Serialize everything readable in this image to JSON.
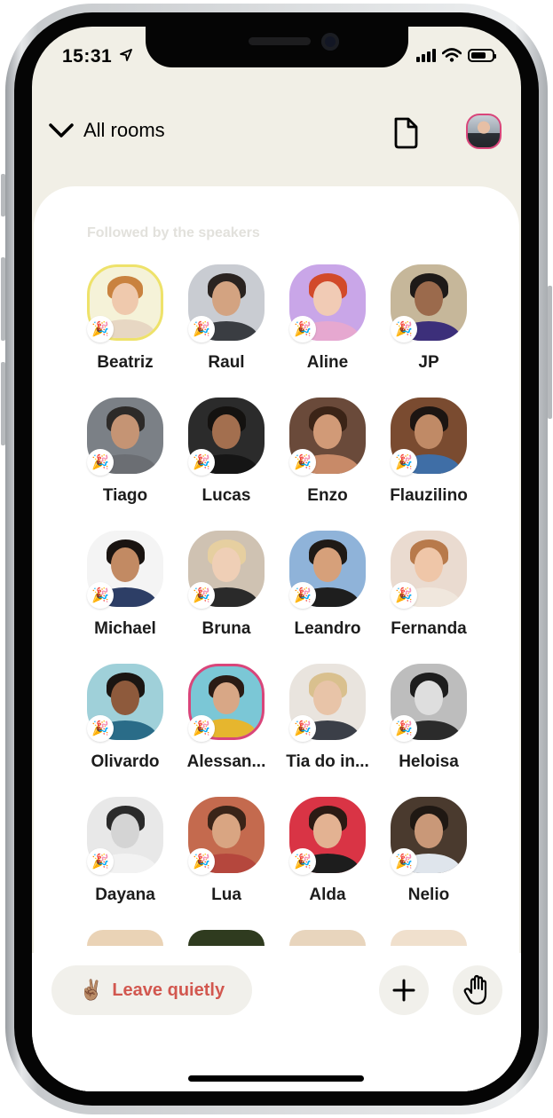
{
  "status_bar": {
    "time": "15:31"
  },
  "header": {
    "back_label": "All rooms"
  },
  "section": {
    "title": "Followed by the speakers"
  },
  "speakers": [
    {
      "name": "Beatriz",
      "ring": "yellow",
      "skin": "#efc9ad",
      "hair": "#c9823f",
      "shirt": "#e7d7c3",
      "bg": "#f5f2d8"
    },
    {
      "name": "Raul",
      "ring": "none",
      "skin": "#d3a381",
      "hair": "#2a2320",
      "shirt": "#3a3d42",
      "bg": "#c9ccd2"
    },
    {
      "name": "Aline",
      "ring": "none",
      "skin": "#f1cbb5",
      "hair": "#d24a2a",
      "shirt": "#e6a8d0",
      "bg": "#c9a6e8"
    },
    {
      "name": "JP",
      "ring": "none",
      "skin": "#9b6a4c",
      "hair": "#1e1a18",
      "shirt": "#3c2f7a",
      "bg": "#c6b79a"
    },
    {
      "name": "Tiago",
      "ring": "none",
      "skin": "#c59474",
      "hair": "#2d2a28",
      "shirt": "#6b6e73",
      "bg": "#7b8086"
    },
    {
      "name": "Lucas",
      "ring": "none",
      "skin": "#a36f4f",
      "hair": "#141210",
      "shirt": "#151515",
      "bg": "#2b2b2b"
    },
    {
      "name": "Enzo",
      "ring": "none",
      "skin": "#d19a77",
      "hair": "#3b2417",
      "shirt": "#c88a68",
      "bg": "#6a4a3a"
    },
    {
      "name": "Flauzilino",
      "ring": "none",
      "skin": "#c08a66",
      "hair": "#1c1512",
      "shirt": "#3f6ea6",
      "bg": "#7a4b30"
    },
    {
      "name": "Michael",
      "ring": "none",
      "skin": "#c28a63",
      "hair": "#1a1411",
      "shirt": "#2d3e66",
      "bg": "#f4f4f4"
    },
    {
      "name": "Bruna",
      "ring": "none",
      "skin": "#efcfb6",
      "hair": "#e6cfa0",
      "shirt": "#2a2a2a",
      "bg": "#cfc2b2"
    },
    {
      "name": "Leandro",
      "ring": "none",
      "skin": "#d6a07a",
      "hair": "#1f1a16",
      "shirt": "#1e1e1e",
      "bg": "#8fb3d9"
    },
    {
      "name": "Fernanda",
      "ring": "none",
      "skin": "#efc6a8",
      "hair": "#b87a4b",
      "shirt": "#f0e7dd",
      "bg": "#eadbd0"
    },
    {
      "name": "Olivardo",
      "ring": "none",
      "skin": "#8e5a3c",
      "hair": "#1a1512",
      "shirt": "#2a6c88",
      "bg": "#9fd0d9"
    },
    {
      "name": "Alessan...",
      "ring": "pink",
      "skin": "#d8a786",
      "hair": "#2a1b15",
      "shirt": "#e6b62e",
      "bg": "#7bc7d6"
    },
    {
      "name": "Tia do in...",
      "ring": "none",
      "skin": "#e8c4a8",
      "hair": "#d9c08e",
      "shirt": "#3b3f48",
      "bg": "#e9e4de"
    },
    {
      "name": "Heloisa",
      "ring": "none",
      "skin": "#dedede",
      "hair": "#1d1d1d",
      "shirt": "#2b2b2b",
      "bg": "#bdbdbd"
    },
    {
      "name": "Dayana",
      "ring": "none",
      "skin": "#d4d4d4",
      "hair": "#2a2a2a",
      "shirt": "#f2f2f2",
      "bg": "#e8e8e8"
    },
    {
      "name": "Lua",
      "ring": "none",
      "skin": "#d9a582",
      "hair": "#3a2418",
      "shirt": "#b5473d",
      "bg": "#c46a4e"
    },
    {
      "name": "Alda",
      "ring": "none",
      "skin": "#e3b292",
      "hair": "#2b1a14",
      "shirt": "#1d1d1d",
      "bg": "#d93445"
    },
    {
      "name": "Nelio",
      "ring": "none",
      "skin": "#c99878",
      "hair": "#1f1813",
      "shirt": "#dfe5ec",
      "bg": "#4a3a2e"
    }
  ],
  "next_row_peek": [
    {
      "bg": "#ead3b6"
    },
    {
      "bg": "#2f3b1f"
    },
    {
      "bg": "#e8d5bd"
    },
    {
      "bg": "#f0e0cd"
    }
  ],
  "badge_icon": "party-popper-icon",
  "footer": {
    "leave_emoji": "✌🏽",
    "leave_label": "Leave quietly",
    "add_icon": "plus-icon",
    "raise_hand_icon": "raised-hand-icon"
  },
  "colors": {
    "background_top": "#f1efe6",
    "accent_red": "#d2574f",
    "ring_pink": "#d9457a",
    "ring_yellow": "#eee26a"
  }
}
